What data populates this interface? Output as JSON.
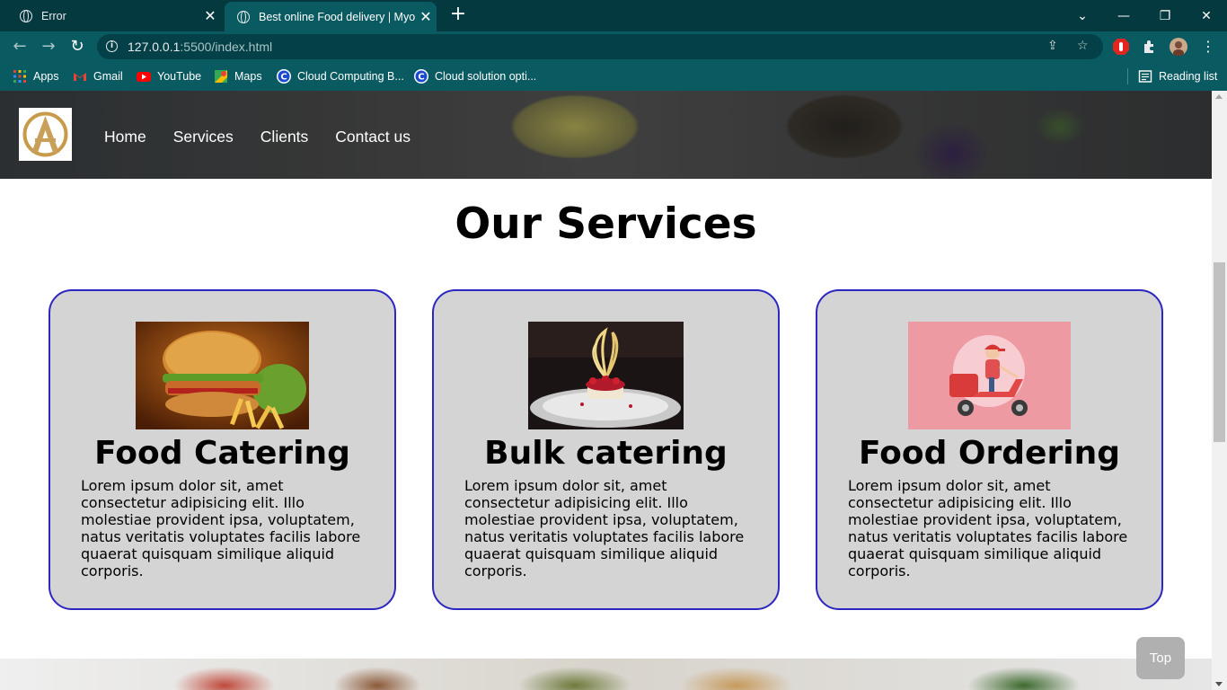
{
  "browser": {
    "tabs": [
      {
        "title": "Error",
        "active": false
      },
      {
        "title": "Best online Food delivery | Myonl",
        "active": true
      }
    ],
    "url_host": "127.0.0.1",
    "url_path": ":5500/index.html",
    "bookmarks": [
      {
        "label": "Apps",
        "icon": "apps-grid-icon"
      },
      {
        "label": "Gmail",
        "icon": "gmail-icon"
      },
      {
        "label": "YouTube",
        "icon": "youtube-icon"
      },
      {
        "label": "Maps",
        "icon": "maps-icon"
      },
      {
        "label": "Cloud Computing B...",
        "icon": "cloud-c-icon"
      },
      {
        "label": "Cloud solution opti...",
        "icon": "cloud-c-icon"
      }
    ],
    "reading_list": "Reading list"
  },
  "site": {
    "nav": [
      "Home",
      "Services",
      "Clients",
      "Contact us"
    ],
    "section_title": "Our Services",
    "cards": [
      {
        "title": "Food Catering",
        "image": "burger-fries-photo",
        "text": "Lorem ipsum dolor sit, amet consectetur adipisicing elit. Illo molestiae provident ipsa, voluptatem, natus veritatis voluptates facilis labore quaerat quisquam similique aliquid corporis."
      },
      {
        "title": "Bulk catering",
        "image": "plated-dessert-photo",
        "text": "Lorem ipsum dolor sit, amet consectetur adipisicing elit. Illo molestiae provident ipsa, voluptatem, natus veritatis voluptates facilis labore quaerat quisquam similique aliquid corporis."
      },
      {
        "title": "Food Ordering",
        "image": "delivery-scooter-illustration",
        "text": "Lorem ipsum dolor sit, amet consectetur adipisicing elit. Illo molestiae provident ipsa, voluptatem, natus veritatis voluptates facilis labore quaerat quisquam similique aliquid corporis."
      }
    ],
    "top_button": "Top"
  },
  "colors": {
    "card_bg": "#d4d4d4",
    "card_border": "#2b27c0",
    "browser_frame": "#0a5a62",
    "tab_strip": "#04393f"
  }
}
